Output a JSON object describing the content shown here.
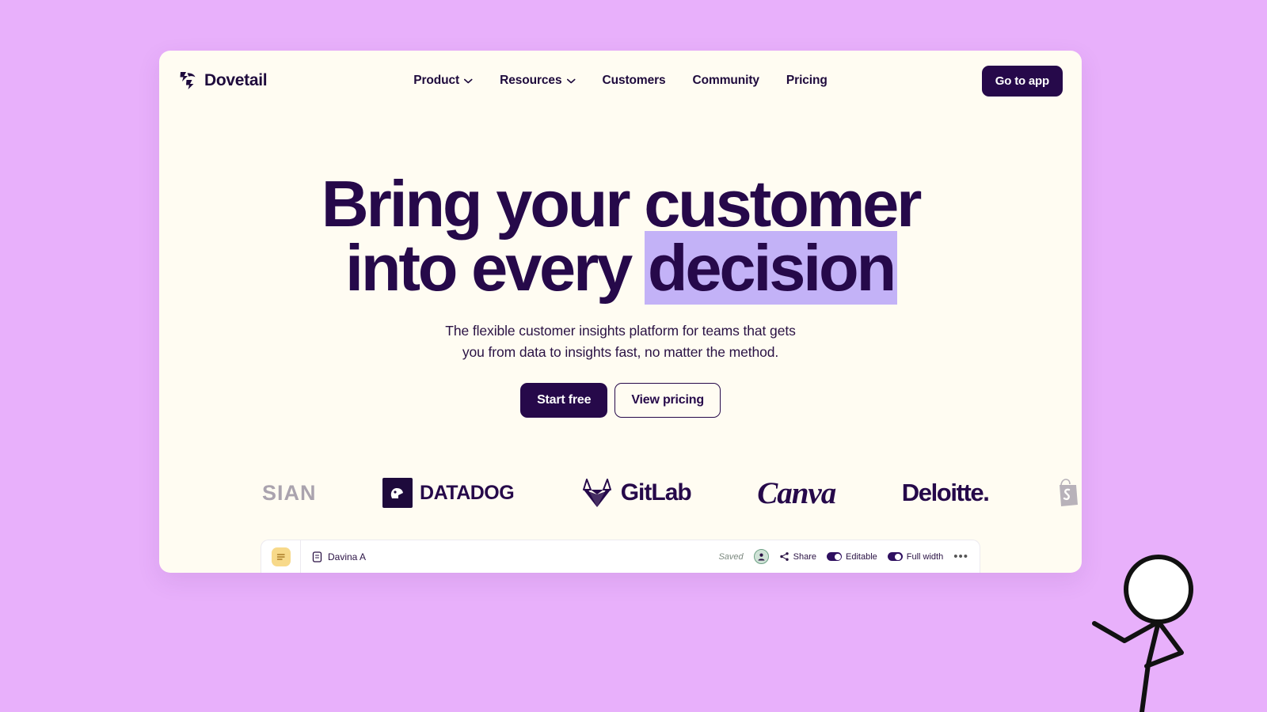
{
  "background_color": "#e8b0fb",
  "card_color": "#fffcf2",
  "brand": {
    "name": "Dovetail",
    "logo_icon": "dovetail-bird-mark"
  },
  "nav": {
    "items": [
      {
        "label": "Product",
        "has_dropdown": true
      },
      {
        "label": "Resources",
        "has_dropdown": true
      },
      {
        "label": "Customers",
        "has_dropdown": false
      },
      {
        "label": "Community",
        "has_dropdown": false
      },
      {
        "label": "Pricing",
        "has_dropdown": false
      }
    ],
    "cta_label": "Go to app"
  },
  "hero": {
    "title_line1": "Bring your customer",
    "title_line2_prefix": "into every ",
    "title_line2_highlight": "decision",
    "highlight_color": "#c3b2f7",
    "text_color": "#26094a",
    "subtitle_line1": "The flexible customer insights platform for teams that gets",
    "subtitle_line2": "you from data to insights fast, no matter the method.",
    "primary_button": "Start free",
    "secondary_button": "View pricing"
  },
  "logos": {
    "atlassian": "SIAN",
    "datadog": "DATADOG",
    "gitlab": "GitLab",
    "canva": "Canva",
    "deloitte": "Deloitte.",
    "shopify": "S"
  },
  "app_preview": {
    "note_icon": "sticky-note-icon",
    "doc_icon": "document-icon",
    "doc_title": "Davina A",
    "saved_status": "Saved",
    "avatar_icon": "user-avatar",
    "share_label": "Share",
    "share_icon": "share-icon",
    "editable_label": "Editable",
    "full_width_label": "Full width",
    "more_label": "•••"
  },
  "decoration": {
    "stick_figure": "stick-figure-drawing"
  }
}
